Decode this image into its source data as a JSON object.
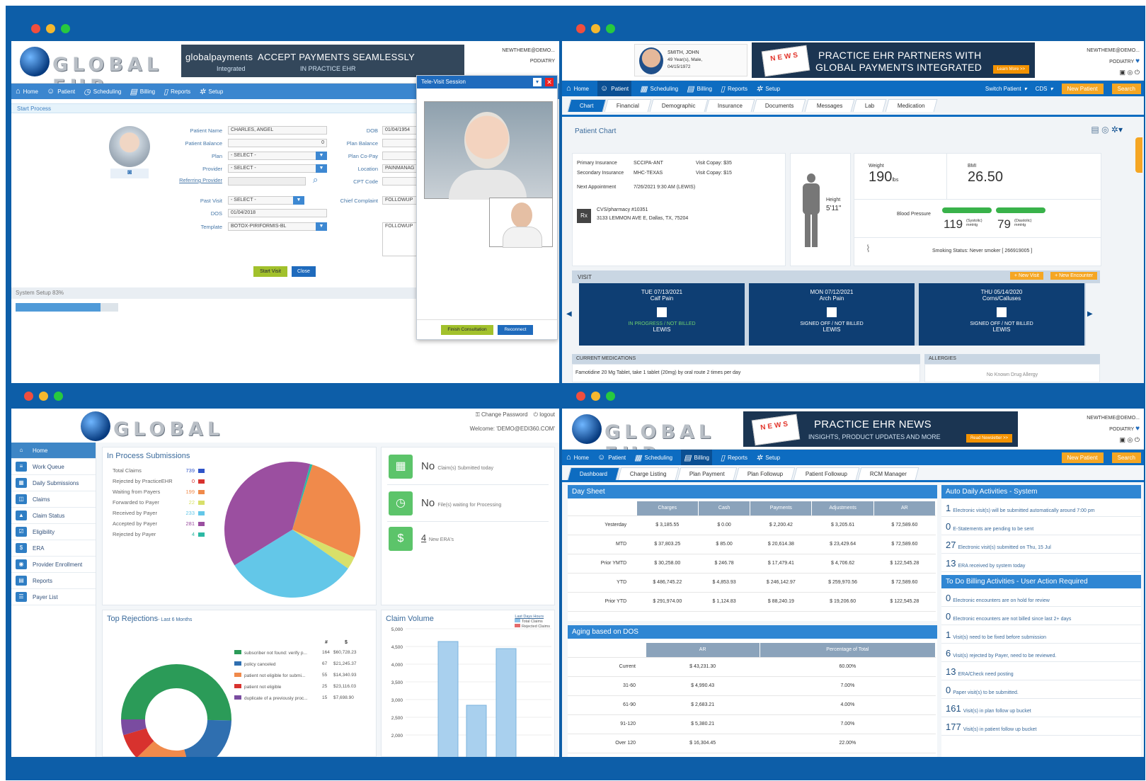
{
  "tl": {
    "banner_brand": "globalpayments",
    "banner_brand_sub": "Integrated",
    "banner_title": "ACCEPT PAYMENTS SEAMLESSLY",
    "banner_sub": "IN PRACTICE EHR",
    "acct_email": "NEWTHEME@DEMO...",
    "acct_spec": "PODIATRY",
    "nav": [
      "Home",
      "Patient",
      "Scheduling",
      "Billing",
      "Reports",
      "Setup"
    ],
    "start_process": "Start Process",
    "labels": {
      "patient_name": "Patient Name",
      "patient_balance": "Patient Balance",
      "plan": "Plan",
      "provider": "Provider",
      "referring": "Referring Provider",
      "past_visit": "Past Visit",
      "dos": "DOS",
      "template": "Template",
      "dob": "DOB",
      "plan_balance": "Plan Balance",
      "plan_copay": "Plan Co-Pay",
      "location": "Location",
      "cpt": "CPT Code",
      "chief": "Chief Complaint"
    },
    "values": {
      "patient_name": "CHARLES, ANGEL",
      "patient_balance": "0",
      "plan": "- SELECT -",
      "provider": "- SELECT -",
      "past_visit": "- SELECT -",
      "dos": "01/04/2018",
      "template": "BOTOX-PIRIFORMIS-BL",
      "dob": "01/04/1954",
      "location": "PAINMANAG",
      "chief": "FOLLOWUP",
      "chief_note": "FOLLOWUP"
    },
    "start_visit": "Start Visit",
    "close": "Close",
    "system_setup": "System Setup 83%",
    "system_setup_pct": 0.83,
    "televisit_title": "Tele-Visit Session",
    "finish": "Finish Consultation",
    "reconnect": "Reconnect"
  },
  "tr": {
    "patient_name": "SMITH, JOHN",
    "patient_age": "49 Year(s), Male,",
    "patient_dob": "04/15/1972",
    "banner_title": "PRACTICE EHR PARTNERS WITH",
    "banner_title2": "GLOBAL PAYMENTS INTEGRATED",
    "banner_cta": "Learn More >>",
    "news": "NEWS",
    "acct_email": "NEWTHEME@DEMO...",
    "acct_spec": "PODIATRY",
    "nav": [
      "Home",
      "Patient",
      "Scheduling",
      "Billing",
      "Reports",
      "Setup"
    ],
    "switch_patient": "Switch Patient",
    "cds": "CDS",
    "new_patient": "New Patient",
    "search": "Search",
    "tabs": [
      "Chart",
      "Financial",
      "Demographic",
      "Insurance",
      "Documents",
      "Messages",
      "Lab",
      "Medication"
    ],
    "chart_title": "Patient Chart",
    "primary_ins_l": "Primary Insurance",
    "primary_ins": "SCCIPA-ANT",
    "secondary_ins_l": "Secondary Insurance",
    "secondary_ins": "MHC-TEXAS",
    "visit_copay1": "Visit Copay: $35",
    "visit_copay2": "Visit Copay: $15",
    "next_appt_l": "Next Appointment",
    "next_appt": "7/26/2021 9:30 AM (LEWIS)",
    "pharmacy": "CVS/pharmacy #10351",
    "pharmacy_addr": "3133 LEMMON AVE E, Dallas, TX, 75204",
    "rx": "Rx",
    "height_l": "Height",
    "height": "5'11\"",
    "weight_l": "Weight",
    "weight": "190",
    "weight_unit": "lbs",
    "bmi_l": "BMI",
    "bmi": "26.50",
    "bp_l": "Blood Pressure",
    "systolic": "119",
    "systolic_l": "(Systolic) mmHg",
    "diastolic": "79",
    "diastolic_l": "(Diastolic) mmHg",
    "smoking": "Smoking Status: Never smoker [ 266919005 ]",
    "visit_hdr": "VISIT",
    "new_visit": "+ New Visit",
    "new_encounter": "+ New Encounter",
    "visits": [
      {
        "date": "TUE 07/13/2021",
        "reason": "Calf Pain",
        "status": "IN PROGRESS / NOT BILLED",
        "provider": "LEWIS"
      },
      {
        "date": "MON 07/12/2021",
        "reason": "Arch Pain",
        "status": "SIGNED OFF / NOT BILLED",
        "provider": "LEWIS"
      },
      {
        "date": "THU 05/14/2020",
        "reason": "Corns/Calluses",
        "status": "SIGNED OFF / NOT BILLED",
        "provider": "LEWIS"
      }
    ],
    "meds_hdr": "CURRENT MEDICATIONS",
    "meds": "Famotidine 20 Mg Tablet, take 1 tablet (20mg) by oral route 2 times per day",
    "allergies_hdr": "ALLERGIES",
    "allergies": "No Known Drug Allergy"
  },
  "bl": {
    "change_password": "Change Password",
    "logout": "logout",
    "welcome": "Welcome: 'DEMO@EDI360.COM'",
    "side": [
      "Home",
      "Work Queue",
      "Daily Submissions",
      "Claims",
      "Claim Status",
      "Eligibility",
      "ERA",
      "Provider Enrollment",
      "Reports",
      "Payer List"
    ],
    "inproc_title": "In Process Submissions",
    "inproc": [
      {
        "label": "Total Claims",
        "value": "739",
        "color": "#2f54c8"
      },
      {
        "label": "Rejected by PracticeEHR",
        "value": "0",
        "color": "#d8322e"
      },
      {
        "label": "Waiting from Payers",
        "value": "199",
        "color": "#f08a4b"
      },
      {
        "label": "Forwarded to Payer",
        "value": "22",
        "color": "#d8e06a"
      },
      {
        "label": "Received by Payer",
        "value": "233",
        "color": "#63c7e8"
      },
      {
        "label": "Accepted by Payer",
        "value": "281",
        "color": "#9b4fa0"
      },
      {
        "label": "Rejected by Payer",
        "value": "4",
        "color": "#2cb9a4"
      }
    ],
    "no1": "No",
    "no1_l": "Claim(s) Submitted today",
    "no2": "No",
    "no2_l": "File(s) waiting for Processing",
    "era_n": "4",
    "era_l": "New ERA's",
    "top_rej": "Top Rejections",
    "top_rej_sub": "- Last 6 Months",
    "rej_hdr": [
      "#",
      "$"
    ],
    "rejections": [
      {
        "label": "subscriber not found: verify p...",
        "n": "164",
        "amt": "$60,728.23",
        "color": "#2b9b58"
      },
      {
        "label": "policy canceled",
        "n": "67",
        "amt": "$21,245.37",
        "color": "#2f6fb0"
      },
      {
        "label": "patient not eligible for submi...",
        "n": "55",
        "amt": "$14,340.93",
        "color": "#f08a4b"
      },
      {
        "label": "patient not eligible",
        "n": "25",
        "amt": "$23,116.03",
        "color": "#d8322e"
      },
      {
        "label": "duplicate of a previously proc...",
        "n": "15",
        "amt": "$7,698.90",
        "color": "#7a4ca0"
      }
    ],
    "claim_volume": "Claim Volume",
    "legend_title": "Last Days Hours",
    "legend": [
      "Total Claims",
      "Rejected Claims"
    ],
    "yticks": [
      "5,000",
      "4,500",
      "4,000",
      "3,500",
      "3,000",
      "2,500",
      "2,000"
    ]
  },
  "br": {
    "banner_title": "PRACTICE EHR NEWS",
    "banner_sub": "INSIGHTS, PRODUCT UPDATES AND MORE",
    "banner_cta": "Read Newsletter >>",
    "news": "NEWS",
    "acct_email": "NEWTHEME@DEMO...",
    "acct_spec": "PODIATRY",
    "nav": [
      "Home",
      "Patient",
      "Scheduling",
      "Billing",
      "Reports",
      "Setup"
    ],
    "new_patient": "New Patient",
    "search": "Search",
    "tabs": [
      "Dashboard",
      "Charge Listing",
      "Plan Payment",
      "Plan Followup",
      "Patient Followup",
      "RCM Manager"
    ],
    "day_sheet": "Day Sheet",
    "ds_cols": [
      "Charges",
      "Cash",
      "Payments",
      "Adjustments",
      "AR"
    ],
    "ds_rows": [
      [
        "Yesterday",
        "$ 3,185.55",
        "$ 0.00",
        "$ 2,200.42",
        "$ 3,205.61",
        "$ 72,589.60"
      ],
      [
        "MTD",
        "$ 37,803.25",
        "$ 85.00",
        "$ 20,614.38",
        "$ 23,429.64",
        "$ 72,589.60"
      ],
      [
        "Prior YMTD",
        "$ 30,258.00",
        "$ 246.78",
        "$ 17,479.41",
        "$ 4,706.62",
        "$ 122,545.28"
      ],
      [
        "YTD",
        "$ 486,745.22",
        "$ 4,853.93",
        "$ 246,142.97",
        "$ 259,970.56",
        "$ 72,589.60"
      ],
      [
        "Prior YTD",
        "$ 291,974.00",
        "$ 1,124.83",
        "$ 88,240.19",
        "$ 19,206.60",
        "$ 122,545.28"
      ]
    ],
    "aging": "Aging based on DOS",
    "aging_cols": [
      "AR",
      "Percentage of Total"
    ],
    "aging_rows": [
      [
        "Current",
        "$ 43,231.30",
        "60.00%"
      ],
      [
        "31-60",
        "$ 4,990.43",
        "7.00%"
      ],
      [
        "61-90",
        "$ 2,683.21",
        "4.00%"
      ],
      [
        "91-120",
        "$ 5,380.21",
        "7.00%"
      ],
      [
        "Over 120",
        "$ 16,304.45",
        "22.00%"
      ]
    ],
    "auto_hdr": "Auto Daily Activities - System",
    "auto": [
      {
        "n": "1",
        "t": "Electronic visit(s) will be submitted automatically around 7:00 pm"
      },
      {
        "n": "0",
        "t": "E-Statements are pending to be sent"
      },
      {
        "n": "27",
        "t": "Electronic visit(s) submitted on Thu, 15 Jul"
      },
      {
        "n": "13",
        "t": "ERA received by system today"
      }
    ],
    "todo_hdr": "To Do Billing Activities - User Action Required",
    "todo": [
      {
        "n": "0",
        "t": "Electronic encounters are on hold for review"
      },
      {
        "n": "0",
        "t": "Electronic encounters are not billed since last 2+ days"
      },
      {
        "n": "1",
        "t": "Visit(s) need to be fixed before submission"
      },
      {
        "n": "6",
        "t": "Visit(s) rejected by Payer, need to be reviewed."
      },
      {
        "n": "13",
        "t": "ERA/Check need posting"
      },
      {
        "n": "0",
        "t": "Paper visit(s) to be submitted."
      },
      {
        "n": "161",
        "t": "Visit(s) in plan follow up bucket"
      },
      {
        "n": "177",
        "t": "Visit(s) in patient follow up bucket"
      }
    ]
  }
}
